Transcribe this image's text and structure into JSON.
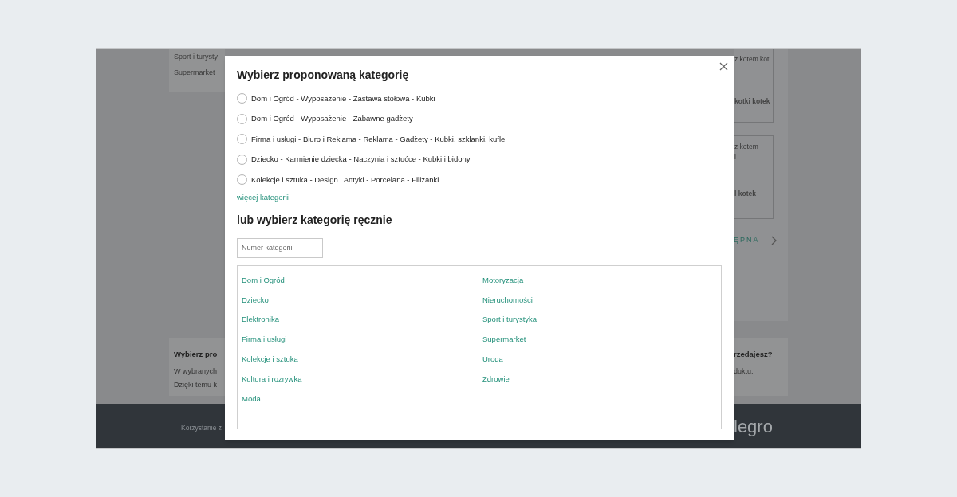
{
  "background": {
    "left_card": {
      "items": [
        "Sport i turysty",
        "Supermarket"
      ]
    },
    "left_info": {
      "title": "Wybierz pro",
      "lines": [
        "W wybranych",
        "Dzięki temu k"
      ]
    },
    "right_cards": [
      {
        "lines": [
          "z kotem kot"
        ],
        "footer": "kotki kotek"
      },
      {
        "lines": [
          "z kotem",
          "l"
        ],
        "footer": "l kotek"
      }
    ],
    "right_link": "ĘPNA",
    "right_info": {
      "title": "rzedajesz?",
      "lines": [
        "duktu."
      ]
    }
  },
  "footer": {
    "text": "Korzystanie z",
    "logo": "legro"
  },
  "modal": {
    "title": "Wybierz proponowaną kategorię",
    "suggestions": [
      {
        "label": "Dom i Ogród - Wyposażenie - Zastawa stołowa - Kubki",
        "selected": false
      },
      {
        "label": "Dom i Ogród - Wyposażenie - Zabawne gadżety",
        "selected": false
      },
      {
        "label": "Firma i usługi - Biuro i Reklama - Reklama - Gadżety - Kubki, szklanki, kufle",
        "selected": false
      },
      {
        "label": "Dziecko - Karmienie dziecka - Naczynia i sztućce - Kubki i bidony",
        "selected": false
      },
      {
        "label": "Kolekcje i sztuka - Design i Antyki - Porcelana - Filiżanki",
        "selected": false
      }
    ],
    "more_link": "więcej kategorii",
    "manual_title": "lub wybierz kategorię ręcznie",
    "number_field": {
      "placeholder": "Numer kategorii"
    },
    "categories": {
      "columns": [
        [
          "Dom i Ogród",
          "Dziecko",
          "Elektronika",
          "Firma i usługi",
          "Kolekcje i sztuka",
          "Kultura i rozrywka",
          "Moda"
        ],
        [
          "Motoryzacja",
          "Nieruchomości",
          "Sport i turystyka",
          "Supermarket",
          "Uroda",
          "Zdrowie"
        ]
      ]
    }
  }
}
